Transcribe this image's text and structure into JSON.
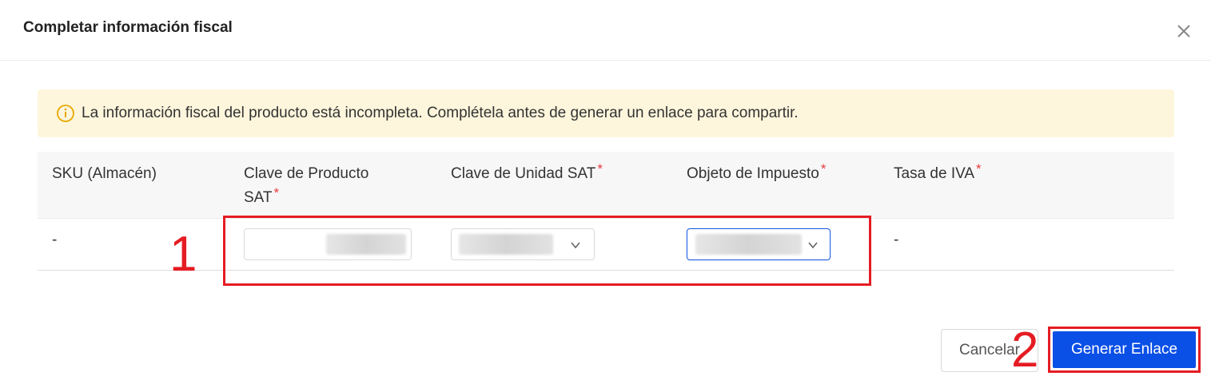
{
  "dialog": {
    "title": "Completar información fiscal",
    "close_icon": "close-icon"
  },
  "alert": {
    "icon": "info-circle-icon",
    "text": "La información fiscal del producto está incompleta. Complétela antes de generar un enlace para compartir.",
    "color": "#fdf6dc"
  },
  "table": {
    "columns": [
      {
        "line1": "SKU (Almacén)",
        "line2": "",
        "required": ""
      },
      {
        "line1": "Clave de Producto",
        "line2": "SAT",
        "required": "*"
      },
      {
        "line1": "Clave de Unidad SAT",
        "line2": "",
        "required": "*"
      },
      {
        "line1": "Objeto de Impuesto",
        "line2": "",
        "required": "*"
      },
      {
        "line1": "Tasa de IVA",
        "line2": "",
        "required": "*"
      }
    ],
    "row": {
      "sku": "-",
      "tasa_iva": "-"
    }
  },
  "annotations": {
    "step1": "1",
    "step2": "2",
    "color": "#e51c23"
  },
  "footer": {
    "cancel_label": "Cancelar",
    "primary_label": "Generar Enlace",
    "primary_color": "#0a4fe6"
  }
}
